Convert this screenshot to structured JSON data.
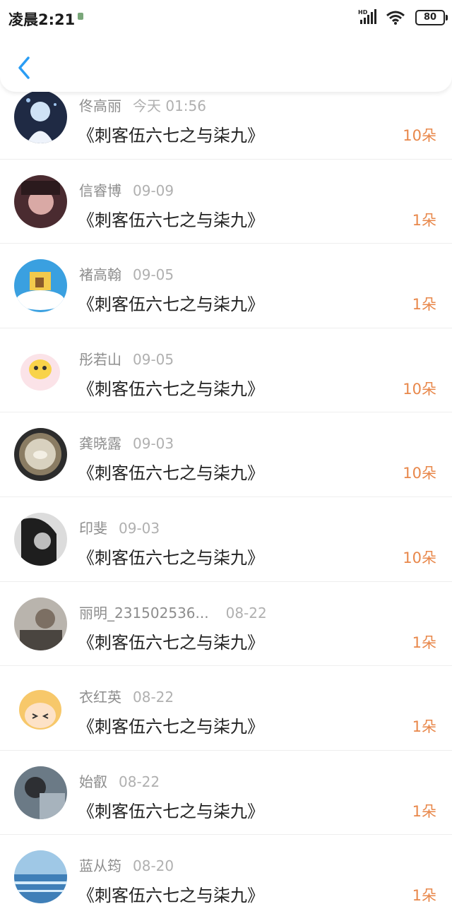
{
  "status_bar": {
    "time": "凌晨2:21",
    "network_label": "HD",
    "battery": "80"
  },
  "header": {
    "back_icon": "chevron-left-icon",
    "accent_color": "#2a9df4"
  },
  "list": {
    "items": [
      {
        "name": "佟高丽",
        "time": "今天 01:56",
        "title": "《刺客伍六七之与柒九》",
        "count": "10朵"
      },
      {
        "name": "信睿博",
        "time": "09-09",
        "title": "《刺客伍六七之与柒九》",
        "count": "1朵"
      },
      {
        "name": "褚高翰",
        "time": "09-05",
        "title": "《刺客伍六七之与柒九》",
        "count": "1朵"
      },
      {
        "name": "彤若山",
        "time": "09-05",
        "title": "《刺客伍六七之与柒九》",
        "count": "10朵"
      },
      {
        "name": "龚晓露",
        "time": "09-03",
        "title": "《刺客伍六七之与柒九》",
        "count": "10朵"
      },
      {
        "name": "印斐",
        "time": "09-03",
        "title": "《刺客伍六七之与柒九》",
        "count": "10朵"
      },
      {
        "name": "丽明_231502536...",
        "time": "08-22",
        "title": "《刺客伍六七之与柒九》",
        "count": "1朵"
      },
      {
        "name": "衣红英",
        "time": "08-22",
        "title": "《刺客伍六七之与柒九》",
        "count": "1朵"
      },
      {
        "name": "始叡",
        "time": "08-22",
        "title": "《刺客伍六七之与柒九》",
        "count": "1朵"
      },
      {
        "name": "蓝从筠",
        "time": "08-20",
        "title": "《刺客伍六七之与柒九》",
        "count": "1朵"
      }
    ]
  },
  "colors": {
    "count": "#e8874a",
    "title": "#222222",
    "meta": "#9a9a9a"
  }
}
